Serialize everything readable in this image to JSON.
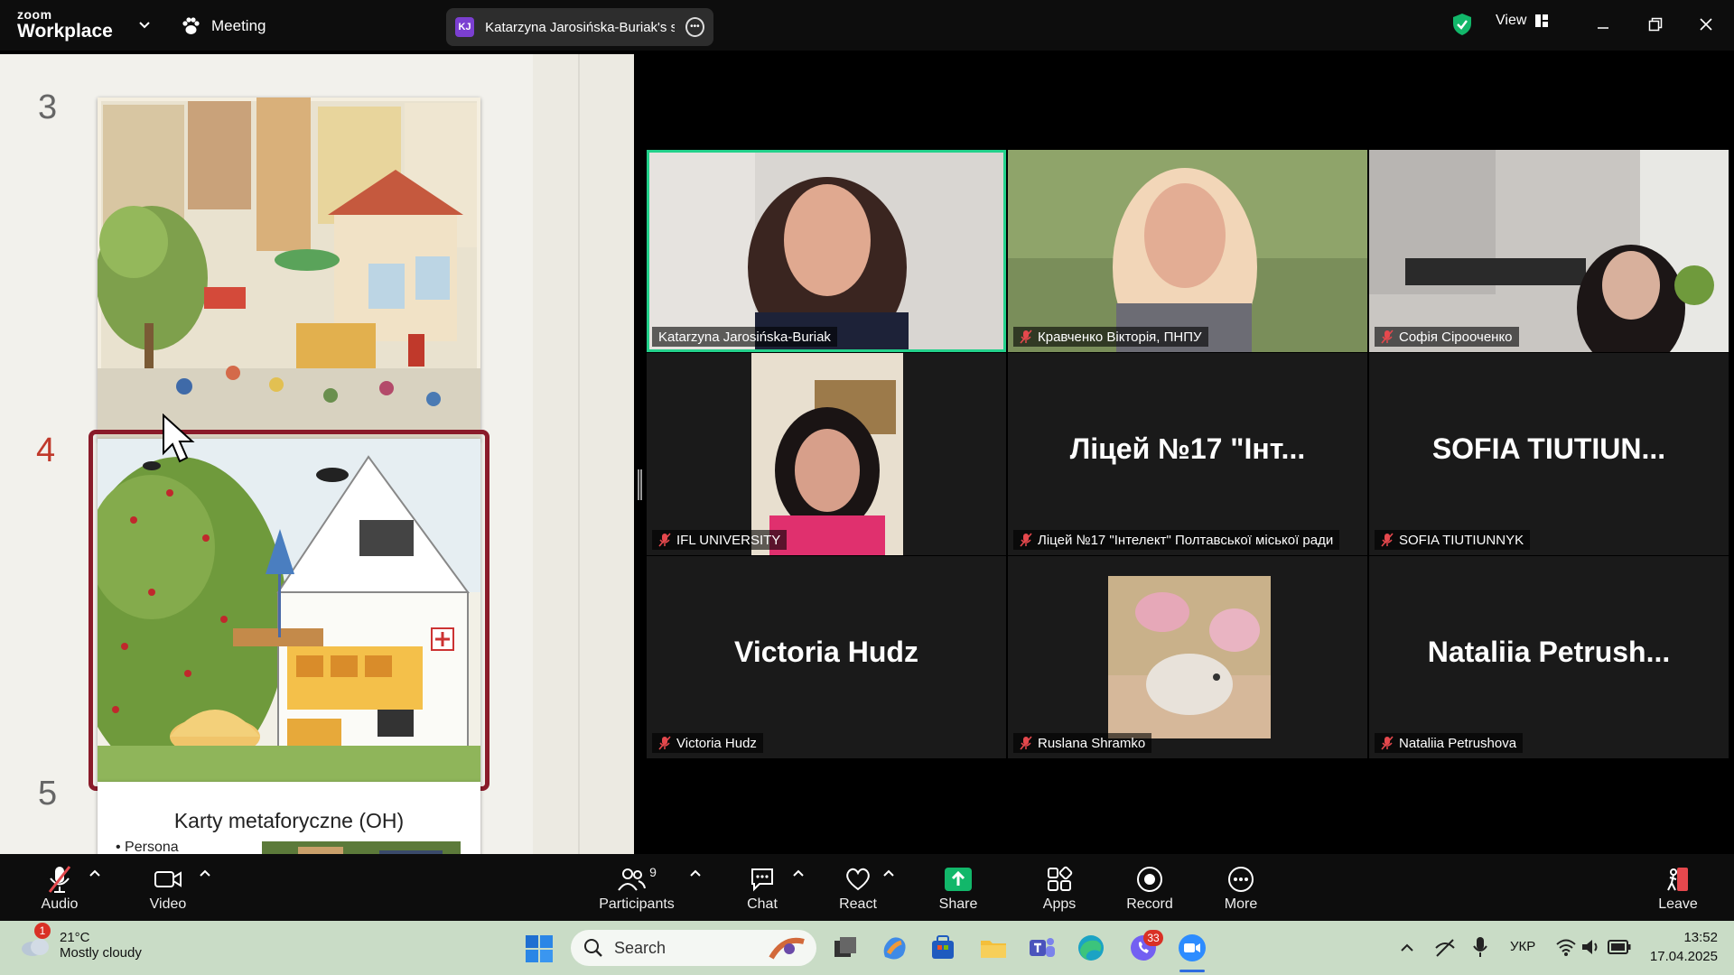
{
  "topbar": {
    "logo_line1": "zoom",
    "logo_line2": "Workplace",
    "meeting_label": "Meeting",
    "share_initials": "KJ",
    "share_title": "Katarzyna Jarosińska-Buriak's scr",
    "view_label": "View"
  },
  "slides": {
    "items": [
      {
        "number": "3"
      },
      {
        "number": "4",
        "selected": true
      },
      {
        "number": "5",
        "title": "Karty metaforyczne (OH)",
        "bullet": "• Persona"
      }
    ]
  },
  "participants": [
    {
      "name": "Katarzyna Jarosińska-Buriak",
      "video": true,
      "active_speaker": true,
      "muted": false
    },
    {
      "name": "Кравченко Вікторія, ПНПУ",
      "video": true,
      "muted": true
    },
    {
      "name": "Софія Сірооченко",
      "video": true,
      "muted": true
    },
    {
      "name": "IFL UNIVERSITY",
      "video": true,
      "muted": true
    },
    {
      "name": "Ліцей №17 \"Інтелект\" Полтавської міської ради",
      "big_name": "Ліцей №17 \"Інт...",
      "video": false,
      "muted": true
    },
    {
      "name": "SOFIA TIUTIUNNYK",
      "big_name": "SOFIA  TIUTIUN...",
      "video": false,
      "muted": true
    },
    {
      "name": "Victoria Hudz",
      "big_name": "Victoria Hudz",
      "video": false,
      "muted": true
    },
    {
      "name": "Ruslana Shramko",
      "video": true,
      "muted": true
    },
    {
      "name": "Nataliia Petrushova",
      "big_name": "Nataliia  Petrush...",
      "video": false,
      "muted": true
    }
  ],
  "toolbar": {
    "audio": "Audio",
    "video": "Video",
    "participants": "Participants",
    "participants_count": "9",
    "chat": "Chat",
    "react": "React",
    "share": "Share",
    "apps": "Apps",
    "record": "Record",
    "more": "More",
    "leave": "Leave"
  },
  "taskbar": {
    "weather_badge": "1",
    "temperature": "21°C",
    "weather_desc": "Mostly cloudy",
    "search_label": "Search",
    "viber_badge": "33",
    "language": "УКР",
    "time": "13:52",
    "date": "17.04.2025"
  },
  "colors": {
    "active_speaker": "#23d18b",
    "selected_slide": "#8a1b2a",
    "share_green": "#12b76a",
    "muted_red": "#e5484d"
  }
}
